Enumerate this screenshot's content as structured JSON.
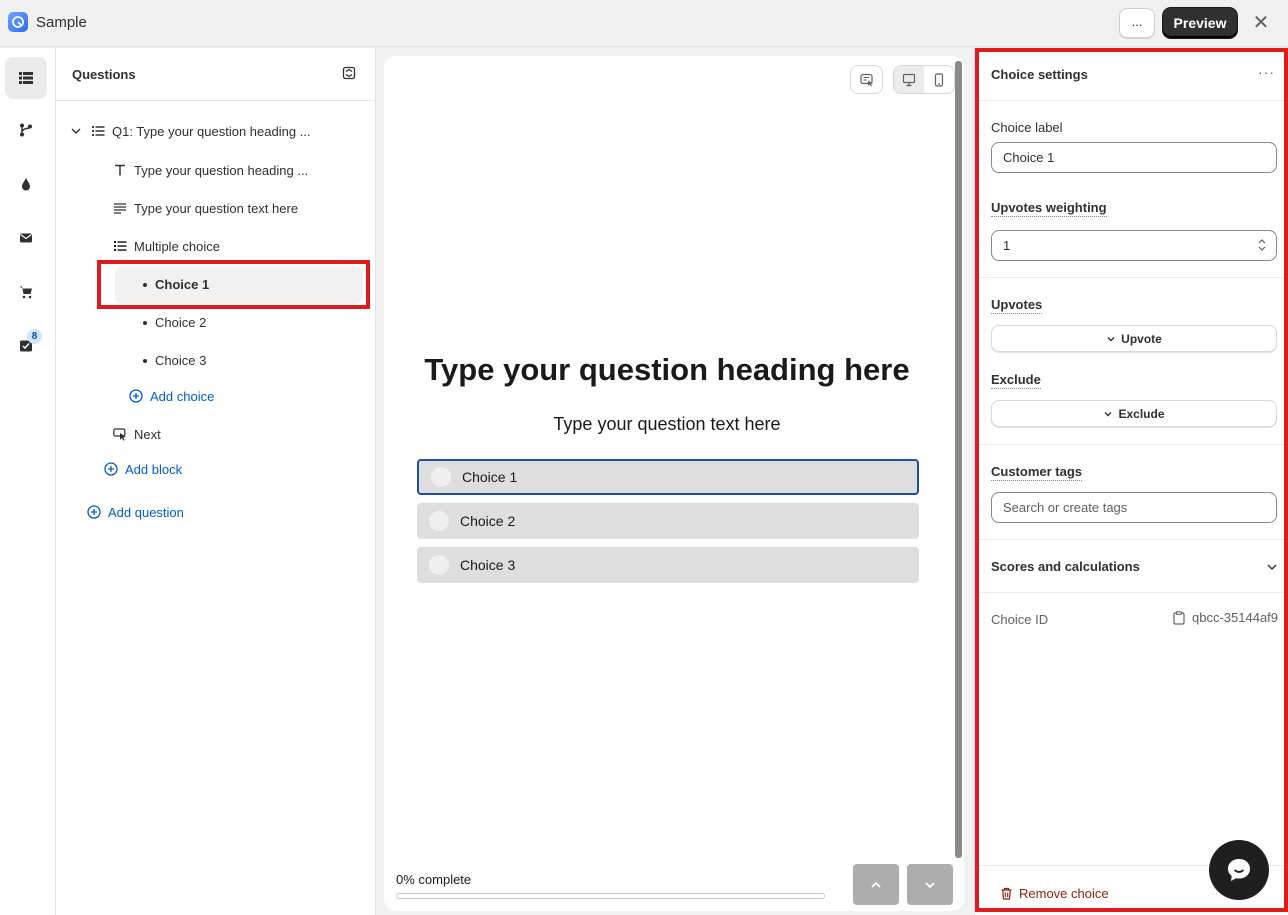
{
  "app": {
    "title": "Sample",
    "more_label": "...",
    "preview_label": "Preview",
    "close_glyph": "✕"
  },
  "rail": {
    "badge_count": "8",
    "icons": [
      "list-icon",
      "branch-icon",
      "droplet-icon",
      "mail-icon",
      "cart-icon",
      "checklist-icon"
    ]
  },
  "questions": {
    "title": "Questions",
    "q1_label": "Q1: Type your question heading ...",
    "blocks": [
      {
        "label": "Type your question heading ...",
        "icon": "text-type-icon"
      },
      {
        "label": "Type your question text here",
        "icon": "paragraph-icon"
      },
      {
        "label": "Multiple choice",
        "icon": "list-icon"
      }
    ],
    "choices": [
      "Choice 1",
      "Choice 2",
      "Choice 3"
    ],
    "add_choice": "Add choice",
    "next_label": "Next",
    "add_block": "Add block",
    "add_question": "Add question"
  },
  "preview": {
    "heading": "Type your question heading here",
    "text": "Type your question text here",
    "choices": [
      "Choice 1",
      "Choice 2",
      "Choice 3"
    ],
    "progress_label": "0% complete",
    "progress_fraction": 0
  },
  "settings": {
    "title": "Choice settings",
    "dots": "···",
    "choice_label_title": "Choice label",
    "choice_label_value": "Choice 1",
    "upvotes_weighting_title": "Upvotes weighting",
    "upvotes_weighting_value": "1",
    "upvotes_title": "Upvotes",
    "upvote_button": "Upvote",
    "exclude_title": "Exclude",
    "exclude_button": "Exclude",
    "customer_tags_title": "Customer tags",
    "customer_tags_placeholder": "Search or create tags",
    "scores_title": "Scores and calculations",
    "choice_id_label": "Choice ID",
    "choice_id_value": "qbcc-35144af9",
    "remove_label": "Remove choice"
  },
  "colors": {
    "highlight_red": "#e01b1b",
    "link_blue": "#005bd3",
    "critical_red": "#8e1f0b",
    "dark_button": "#303030"
  }
}
